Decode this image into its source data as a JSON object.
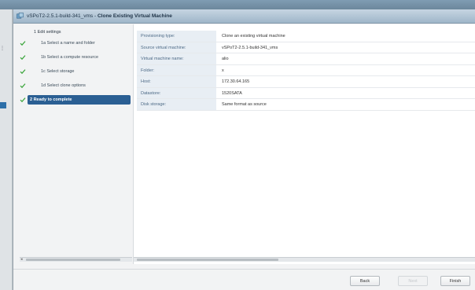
{
  "dialog": {
    "title_prefix": "vSPoT2-2.5.1-build-341_vms - ",
    "title_main": "Clone Existing Virtual Machine"
  },
  "nav": {
    "items": [
      {
        "label": "1 Edit settings",
        "checked": false,
        "active": false
      },
      {
        "label": "1a  Select a name and folder",
        "checked": true,
        "active": false
      },
      {
        "label": "1b  Select a compute resource",
        "checked": true,
        "active": false
      },
      {
        "label": "1c  Select storage",
        "checked": true,
        "active": false
      },
      {
        "label": "1d  Select clone options",
        "checked": true,
        "active": false
      },
      {
        "label": "2  Ready to complete",
        "checked": true,
        "active": true
      }
    ]
  },
  "summary": {
    "rows": [
      {
        "key": "Provisioning type:",
        "value": "Clone an existing virtual machine"
      },
      {
        "key": "Source virtual machine:",
        "value": "vSPoT2-2.5.1-build-341_vms"
      },
      {
        "key": "Virtual machine name:",
        "value": "alio"
      },
      {
        "key": "Folder:",
        "value": "x"
      },
      {
        "key": "Host:",
        "value": "172.30.64.165"
      },
      {
        "key": "Datastore:",
        "value": "1520SATA"
      },
      {
        "key": "Disk storage:",
        "value": "Same format as source"
      }
    ]
  },
  "footer": {
    "back_label": "Back",
    "next_label": "Next",
    "finish_label": "Finish"
  },
  "colors": {
    "accent": "#2b5f93",
    "check": "#3aa53a",
    "key_bg": "#e8eef4"
  }
}
